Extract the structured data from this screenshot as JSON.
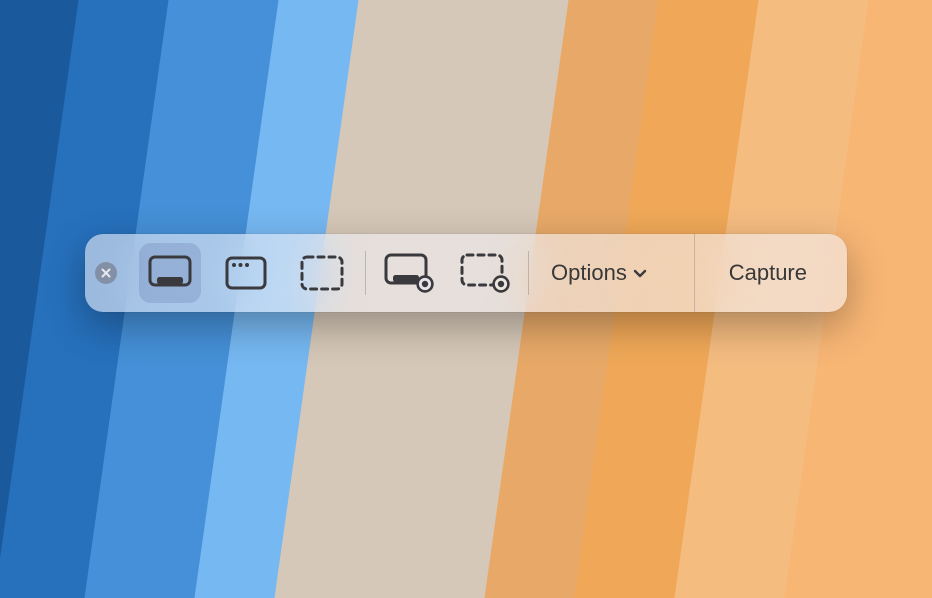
{
  "toolbar": {
    "options_label": "Options",
    "capture_label": "Capture",
    "icons": {
      "close": "close-icon",
      "capture_entire_screen": "capture-entire-screen-icon",
      "capture_window": "capture-window-icon",
      "capture_selection": "capture-selection-icon",
      "record_entire_screen": "record-entire-screen-icon",
      "record_selection": "record-selection-icon",
      "chevron_down": "chevron-down-icon"
    },
    "selected_tool": "capture_entire_screen"
  },
  "colors": {
    "icon_stroke": "#3a3a3e",
    "selected_bg": "rgba(90,110,160,0.24)"
  }
}
